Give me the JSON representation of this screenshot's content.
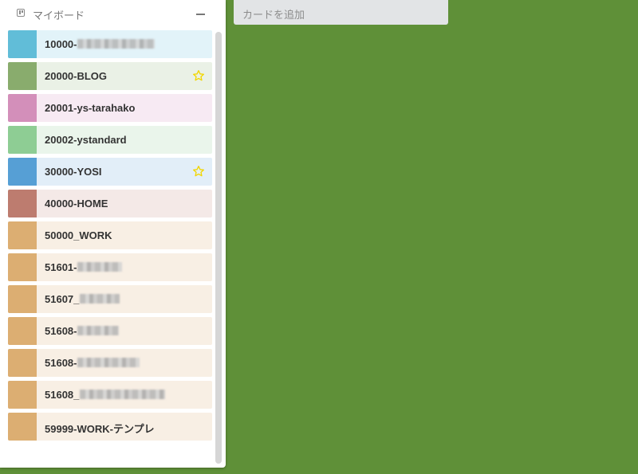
{
  "sidebar": {
    "title": "マイボード",
    "boards": [
      {
        "label": "10000-",
        "color": "#61bdd8",
        "bg": "#e2f3f9",
        "blurred": true,
        "blur_w": 97,
        "starred": false
      },
      {
        "label": "20000-BLOG",
        "color": "#89ac6d",
        "bg": "#eaf1e6",
        "blurred": false,
        "blur_w": 0,
        "starred": true
      },
      {
        "label": "20001-ys-tarahako",
        "color": "#d38fba",
        "bg": "#f7eaf3",
        "blurred": false,
        "blur_w": 0,
        "starred": false
      },
      {
        "label": "20002-ystandard",
        "color": "#8ecd94",
        "bg": "#eaf5eb",
        "blurred": false,
        "blur_w": 0,
        "starred": false
      },
      {
        "label": "30000-YOSI",
        "color": "#569fd5",
        "bg": "#e2eef8",
        "blurred": false,
        "blur_w": 0,
        "starred": true
      },
      {
        "label": "40000-HOME",
        "color": "#bd7c6f",
        "bg": "#f4e9e7",
        "blurred": false,
        "blur_w": 0,
        "starred": false
      },
      {
        "label": "50000_WORK",
        "color": "#dcae72",
        "bg": "#f8efe4",
        "blurred": false,
        "blur_w": 0,
        "starred": false
      },
      {
        "label": "51601-",
        "color": "#dcae72",
        "bg": "#f8efe4",
        "blurred": true,
        "blur_w": 56,
        "starred": false
      },
      {
        "label": "51607_",
        "color": "#dcae72",
        "bg": "#f8efe4",
        "blurred": true,
        "blur_w": 50,
        "starred": false
      },
      {
        "label": "51608-",
        "color": "#dcae72",
        "bg": "#f8efe4",
        "blurred": true,
        "blur_w": 52,
        "starred": false
      },
      {
        "label": "51608-",
        "color": "#dcae72",
        "bg": "#f8efe4",
        "blurred": true,
        "blur_w": 78,
        "starred": false
      },
      {
        "label": "51608_",
        "color": "#dcae72",
        "bg": "#f8efe4",
        "blurred": true,
        "blur_w": 107,
        "starred": false
      },
      {
        "label": "59999-WORK-テンプレ",
        "color": "#dcae72",
        "bg": "#f8efe4",
        "blurred": false,
        "blur_w": 0,
        "starred": false
      }
    ],
    "star_color": "#f2d600"
  },
  "main": {
    "add_card_label": "カードを追加",
    "background_color": "#5f9038"
  }
}
